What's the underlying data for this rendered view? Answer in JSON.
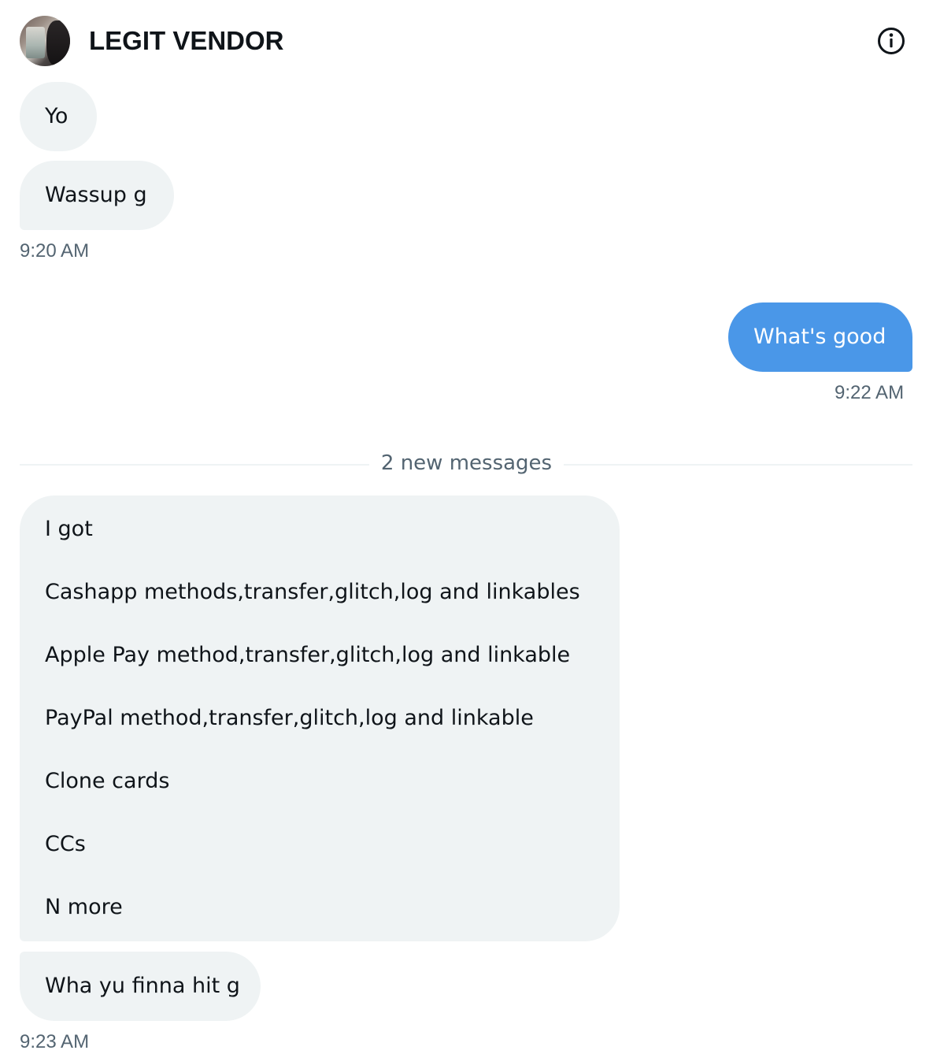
{
  "header": {
    "contact_name": "LEGIT VENDOR",
    "info_icon": "info-circle-icon",
    "avatar_icon": "contact-avatar"
  },
  "conversation": {
    "messages": [
      {
        "direction": "incoming",
        "text": "Yo"
      },
      {
        "direction": "incoming",
        "text": "Wassup g"
      },
      {
        "direction": "outgoing",
        "text": "What's good"
      },
      {
        "direction": "incoming",
        "lines": [
          "I got",
          "Cashapp methods,transfer,glitch,log and linkables",
          "Apple Pay method,transfer,glitch,log and linkable",
          "PayPal method,transfer,glitch,log and linkable",
          "Clone cards",
          "CCs",
          "N more"
        ]
      },
      {
        "direction": "incoming",
        "text": "Wha yu finna hit g"
      }
    ],
    "timestamps": [
      "9:20 AM",
      "9:22 AM",
      "9:23 AM"
    ],
    "new_messages_divider": "2 new messages"
  },
  "colors": {
    "incoming_bubble": "#eff3f4",
    "outgoing_bubble": "#4a97e8",
    "timestamp": "#536471",
    "text": "#0f1419"
  }
}
